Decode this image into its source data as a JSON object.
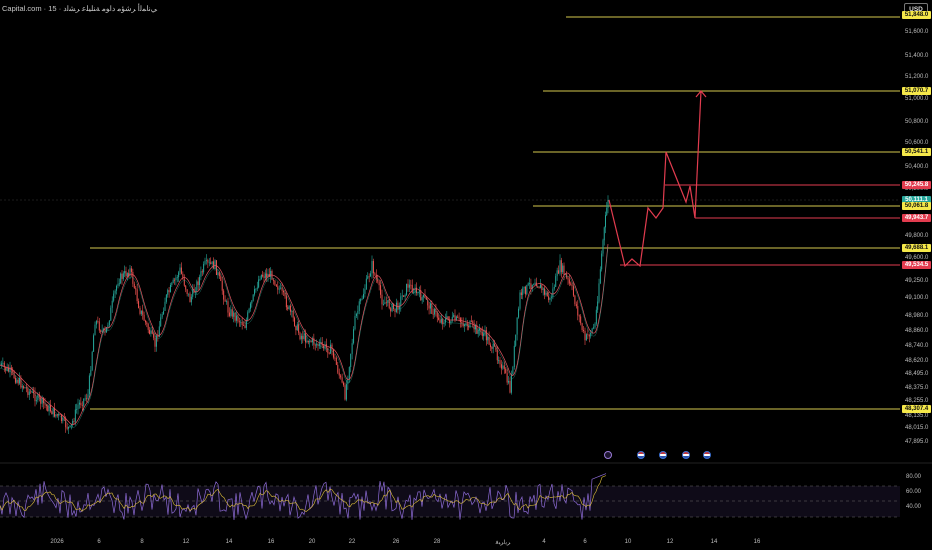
{
  "header": {
    "title": "Capital.com · 15 · ﻲﻧﺎﻤﻟﺃ ﺮﺷﺆﻣ ﺩﺍﻮﻣ ﺔﻨﻠﻴﻠﻋ ﺮﺸﻟﺩ",
    "currency": "USD"
  },
  "colors": {
    "background": "#000000",
    "up_candle": "#26a69a",
    "down_candle": "#ef5350",
    "level_line": "#d4c94e",
    "red_line": "#e23c4f",
    "projection": "#e23c4f",
    "rsi_line": "#8d6bd6",
    "rsi_ma": "#e0c13a",
    "price_yellow": "#f5e84a",
    "price_red": "#e23c4f",
    "price_green": "#26a69a"
  },
  "price_axis_ticks": [
    "51,600.0",
    "51,400.0",
    "51,200.0",
    "51,000.0",
    "50,800.0",
    "50,600.0",
    "50,400.0",
    "50,200.0",
    "49,800.0",
    "49,600.0",
    "49,250.0",
    "49,100.0",
    "48,980.0",
    "48,860.0",
    "48,740.0",
    "48,620.0",
    "48,495.0",
    "48,375.0",
    "48,255.0",
    "48,135.0",
    "48,015.0",
    "47,895.0"
  ],
  "price_labels": [
    {
      "text": "51,848.0",
      "kind": "yellow"
    },
    {
      "text": "51,070.7",
      "kind": "yellow"
    },
    {
      "text": "50,541.1",
      "kind": "yellow"
    },
    {
      "text": "50,245.8",
      "kind": "red"
    },
    {
      "text": "50,111.1",
      "kind": "green"
    },
    {
      "text": "50,061.8",
      "kind": "yellow"
    },
    {
      "text": "49,943.7",
      "kind": "red"
    },
    {
      "text": "49,688.1",
      "kind": "yellow"
    },
    {
      "text": "49,534.5",
      "kind": "red"
    },
    {
      "text": "48,307.4",
      "kind": "yellow"
    }
  ],
  "time_axis_ticks": [
    "2026",
    "6",
    "8",
    "12",
    "14",
    "16",
    "20",
    "22",
    "26",
    "28",
    "ﺮﻳﺍﺮﺒﻓ",
    "4",
    "6",
    "10",
    "12",
    "14",
    "16"
  ],
  "rsi": {
    "ticks": [
      "80.00",
      "60.00",
      "40.00"
    ],
    "upper": 70,
    "lower": 30,
    "mid": 50
  },
  "events": [
    {
      "icon": "lightning-icon"
    },
    {
      "icon": "us-flag-icon"
    },
    {
      "icon": "us-flag-icon"
    },
    {
      "icon": "us-flag-icon"
    },
    {
      "icon": "us-flag-icon"
    }
  ]
}
